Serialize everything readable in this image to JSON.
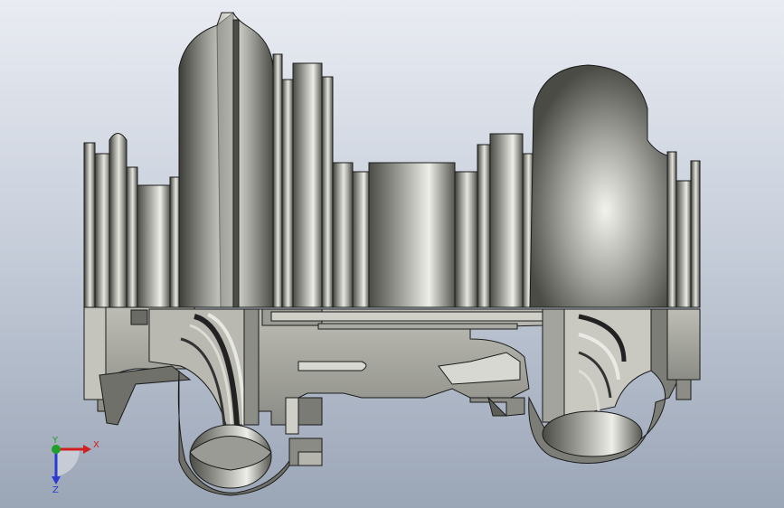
{
  "viewport": {
    "background_top": "#e9ecf2",
    "background_bottom": "#9aa5b6"
  },
  "model": {
    "subject": "turbocharger-cross-section",
    "body_color": "#8f9089",
    "section_color": "#cfcfc8",
    "highlight_color": "#f4f4ee",
    "edge_color": "#1a1a1a"
  },
  "triad": {
    "x_label": "X",
    "y_label": "Y",
    "z_label": "Z",
    "x_color": "#d21f1f",
    "y_color": "#1fa02a",
    "z_color": "#2a3ad2"
  }
}
